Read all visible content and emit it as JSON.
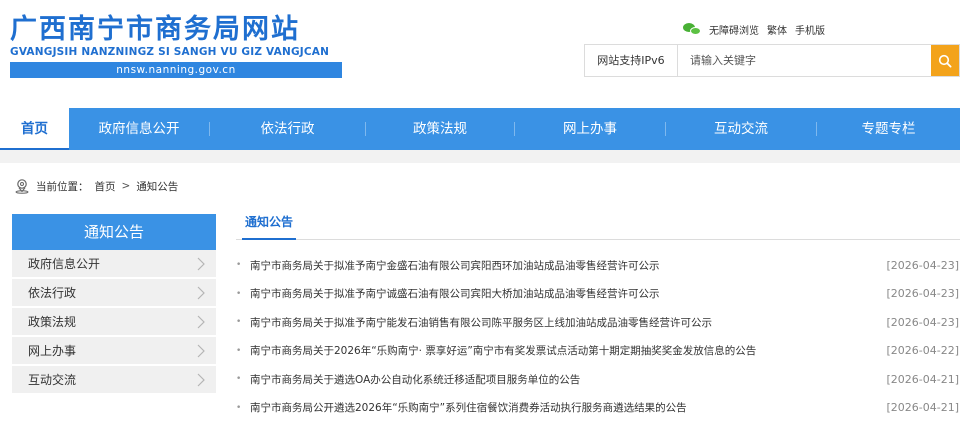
{
  "header": {
    "logo_cn": "广西南宁市商务局网站",
    "logo_pinyin": "GVANGJSIH NANZNINGZ SI SANGH VU GIZ VANGJCAN",
    "logo_domain": "nnsw.nanning.gov.cn",
    "toplinks": [
      "无障碍浏览",
      "繁体",
      "手机版"
    ],
    "ipv6": "网站支持IPv6",
    "search_placeholder": "请输入关键字"
  },
  "nav": {
    "items": [
      {
        "label": "首页",
        "active": true
      },
      {
        "label": "政府信息公开"
      },
      {
        "label": "依法行政"
      },
      {
        "label": "政策法规"
      },
      {
        "label": "网上办事"
      },
      {
        "label": "互动交流"
      },
      {
        "label": "专题专栏"
      }
    ]
  },
  "breadcrumb": {
    "prefix": "当前位置：",
    "home": "首页",
    "separator": ">",
    "current": "通知公告"
  },
  "sidebar": {
    "title": "通知公告",
    "items": [
      "政府信息公开",
      "依法行政",
      "政策法规",
      "网上办事",
      "互动交流"
    ]
  },
  "content": {
    "title": "通知公告",
    "rows": [
      {
        "title": "南宁市商务局关于拟准予南宁金盛石油有限公司宾阳西环加油站成品油零售经营许可公示",
        "date": "[2026-04-23]"
      },
      {
        "title": "南宁市商务局关于拟准予南宁诚盛石油有限公司宾阳大桥加油站成品油零售经营许可公示",
        "date": "[2026-04-23]"
      },
      {
        "title": "南宁市商务局关于拟准予南宁能发石油销售有限公司陈平服务区上线加油站成品油零售经营许可公示",
        "date": "[2026-04-23]"
      },
      {
        "title": "南宁市商务局关于2026年“乐购南宁· 票享好运”南宁市有奖发票试点活动第十期定期抽奖奖金发放信息的公告",
        "date": "[2026-04-22]"
      },
      {
        "title": "南宁市商务局关于遴选OA办公自动化系统迁移适配项目服务单位的公告",
        "date": "[2026-04-21]"
      },
      {
        "title": "南宁市商务局公开遴选2026年“乐购南宁”系列住宿餐饮消费券活动执行服务商遴选结果的公告",
        "date": "[2026-04-21]"
      }
    ]
  },
  "colors": {
    "brand_blue": "#1f6fd0",
    "nav_blue": "#3a92e5",
    "search_orange": "#f3a31b"
  },
  "icons": {
    "wechat": "wechat-icon",
    "search": "search-icon",
    "location": "location-pin-icon",
    "chevron": "chevron-right-icon"
  }
}
